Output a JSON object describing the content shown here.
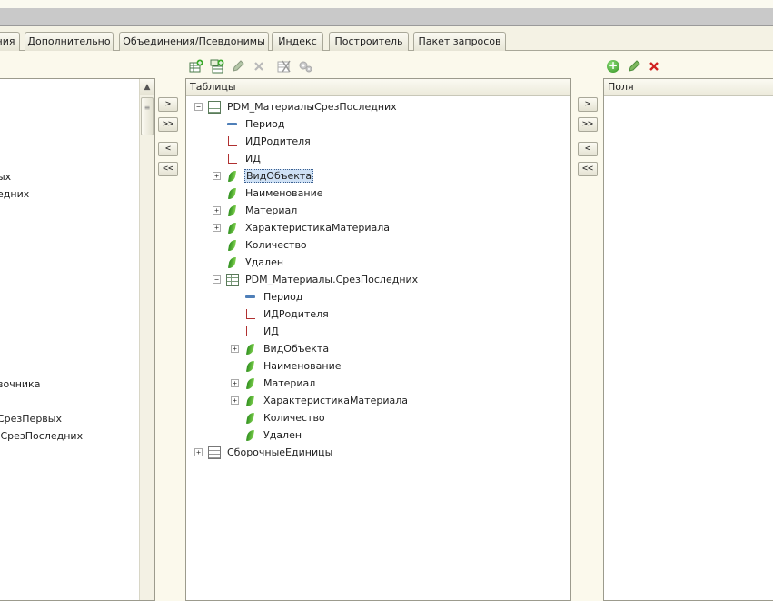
{
  "tabs": [
    {
      "label": "ния"
    },
    {
      "label": "Дополнительно"
    },
    {
      "label": "Объединения/Псевдонимы"
    },
    {
      "label": "Индекс"
    },
    {
      "label": "Построитель"
    },
    {
      "label": "Пакет запросов"
    }
  ],
  "toolbar": {
    "icons": [
      "add-table-icon",
      "add-nested-icon",
      "edit-icon",
      "delete-icon",
      "cut-icon",
      "settings-icon"
    ]
  },
  "left_panel": {
    "items": [
      {
        "label": "ых"
      },
      {
        "label": "едних"
      },
      {
        "label": "вочника"
      },
      {
        "label": "."
      },
      {
        "label": "СрезПервых"
      },
      {
        "label": ".СрезПоследних"
      }
    ]
  },
  "move_buttons": [
    ">",
    ">>",
    "<",
    "<<"
  ],
  "tables_panel": {
    "header": "Таблицы",
    "tree": [
      {
        "label": "PDM_МатериалыСрезПоследних",
        "icon": "table-icon",
        "expander": "⊖",
        "level": 0
      },
      {
        "label": "Период",
        "icon": "dimension-icon",
        "expander": "",
        "level": 1
      },
      {
        "label": "ИДРодителя",
        "icon": "reference-icon",
        "expander": "",
        "level": 1
      },
      {
        "label": "ИД",
        "icon": "reference-icon",
        "expander": "",
        "level": 1
      },
      {
        "label": "ВидОбъекта",
        "icon": "attribute-icon",
        "expander": "⊕",
        "level": 1,
        "selected": true
      },
      {
        "label": "Наименование",
        "icon": "attribute-icon",
        "expander": "",
        "level": 1
      },
      {
        "label": "Материал",
        "icon": "attribute-icon",
        "expander": "⊕",
        "level": 1
      },
      {
        "label": "ХарактеристикаМатериала",
        "icon": "attribute-icon",
        "expander": "⊕",
        "level": 1
      },
      {
        "label": "Количество",
        "icon": "attribute-icon",
        "expander": "",
        "level": 1
      },
      {
        "label": "Удален",
        "icon": "attribute-icon",
        "expander": "",
        "level": 1
      },
      {
        "label": "PDM_Материалы.СрезПоследних",
        "icon": "table-icon",
        "expander": "⊖",
        "level": 1
      },
      {
        "label": "Период",
        "icon": "dimension-icon",
        "expander": "",
        "level": 2
      },
      {
        "label": "ИДРодителя",
        "icon": "reference-icon",
        "expander": "",
        "level": 2
      },
      {
        "label": "ИД",
        "icon": "reference-icon",
        "expander": "",
        "level": 2
      },
      {
        "label": "ВидОбъекта",
        "icon": "attribute-icon",
        "expander": "⊕",
        "level": 2
      },
      {
        "label": "Наименование",
        "icon": "attribute-icon",
        "expander": "",
        "level": 2
      },
      {
        "label": "Материал",
        "icon": "attribute-icon",
        "expander": "⊕",
        "level": 2
      },
      {
        "label": "ХарактеристикаМатериала",
        "icon": "attribute-icon",
        "expander": "⊕",
        "level": 2
      },
      {
        "label": "Количество",
        "icon": "attribute-icon",
        "expander": "",
        "level": 2
      },
      {
        "label": "Удален",
        "icon": "attribute-icon",
        "expander": "",
        "level": 2
      },
      {
        "label": "СборочныеЕдиницы",
        "icon": "table-gray-icon",
        "expander": "⊕",
        "level": 0
      }
    ]
  },
  "fields_panel": {
    "header": "Поля"
  },
  "colors": {
    "accent_green": "#2f8f1f",
    "delete_red": "#d02020",
    "selection": "#cfe1f5"
  }
}
